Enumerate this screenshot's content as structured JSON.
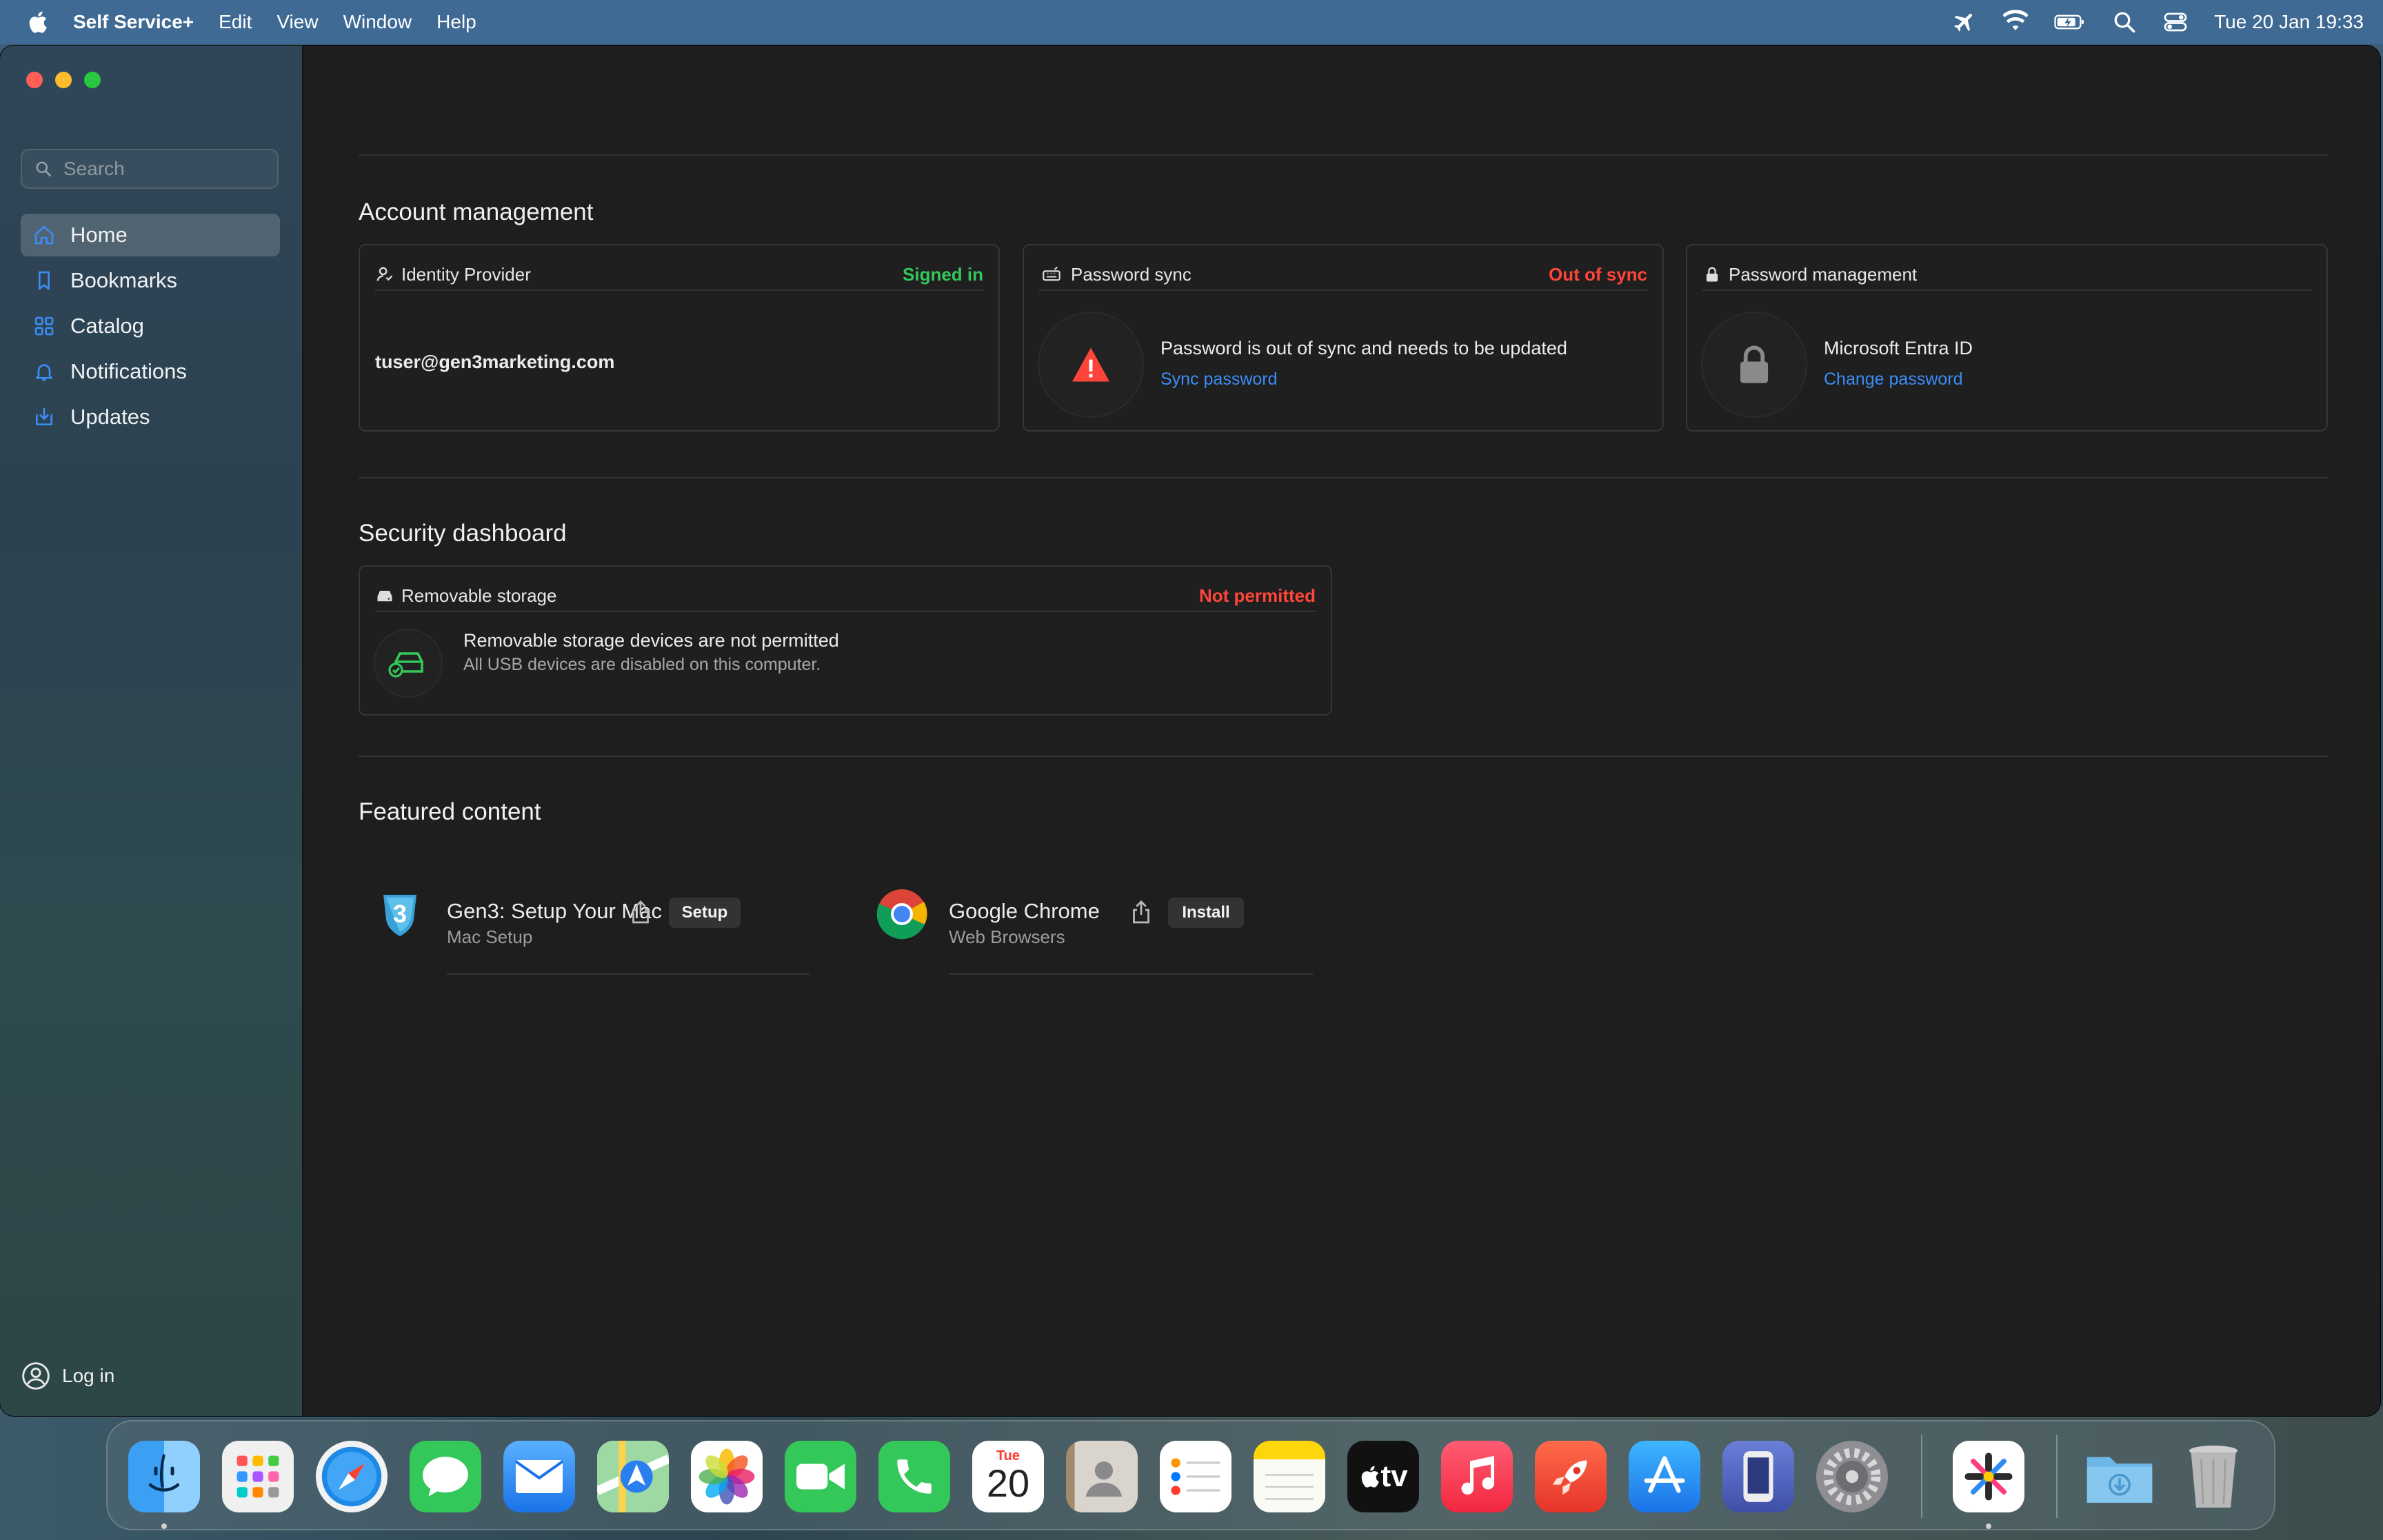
{
  "menubar": {
    "app_name": "Self Service+",
    "items": [
      "Edit",
      "View",
      "Window",
      "Help"
    ],
    "clock": "Tue 20 Jan  19:33"
  },
  "sidebar": {
    "search_placeholder": "Search",
    "items": [
      {
        "label": "Home",
        "icon": "home-icon",
        "active": true
      },
      {
        "label": "Bookmarks",
        "icon": "bookmark-icon",
        "active": false
      },
      {
        "label": "Catalog",
        "icon": "grid-icon",
        "active": false
      },
      {
        "label": "Notifications",
        "icon": "bell-icon",
        "active": false
      },
      {
        "label": "Updates",
        "icon": "download-icon",
        "active": false
      }
    ],
    "login_label": "Log in"
  },
  "account": {
    "title": "Account management",
    "identity": {
      "heading": "Identity Provider",
      "status": "Signed in",
      "user": "tuser@gen3marketing.com"
    },
    "sync": {
      "heading": "Password sync",
      "status": "Out of sync",
      "message": "Password is out of sync and needs to be updated",
      "action": "Sync password"
    },
    "password": {
      "heading": "Password management",
      "provider": "Microsoft Entra ID",
      "action": "Change password"
    }
  },
  "security": {
    "title": "Security dashboard",
    "storage": {
      "heading": "Removable storage",
      "status": "Not permitted",
      "message": "Removable storage devices are not permitted",
      "detail": "All USB devices are disabled on this computer."
    }
  },
  "featured": {
    "title": "Featured content",
    "items": [
      {
        "name": "Gen3: Setup Your Mac",
        "category": "Mac Setup",
        "button": "Setup",
        "badge": "3"
      },
      {
        "name": "Google Chrome",
        "category": "Web Browsers",
        "button": "Install"
      }
    ]
  },
  "dock": {
    "calendar_day": "Tue",
    "calendar_date": "20",
    "tv_label": "tv",
    "apps": [
      "Finder",
      "Launchpad",
      "Safari",
      "Messages",
      "Mail",
      "Maps",
      "Photos",
      "FaceTime",
      "Phone",
      "Calendar",
      "Contacts",
      "Reminders",
      "Notes",
      "TV",
      "Music",
      "Rocket",
      "App Store",
      "Simulator",
      "System Settings",
      "Self Service+",
      "Downloads",
      "Trash"
    ]
  },
  "colors": {
    "ok": "#35c759",
    "bad": "#ff453a",
    "link": "#3b8cf5",
    "menubar": "#3f6a94"
  }
}
